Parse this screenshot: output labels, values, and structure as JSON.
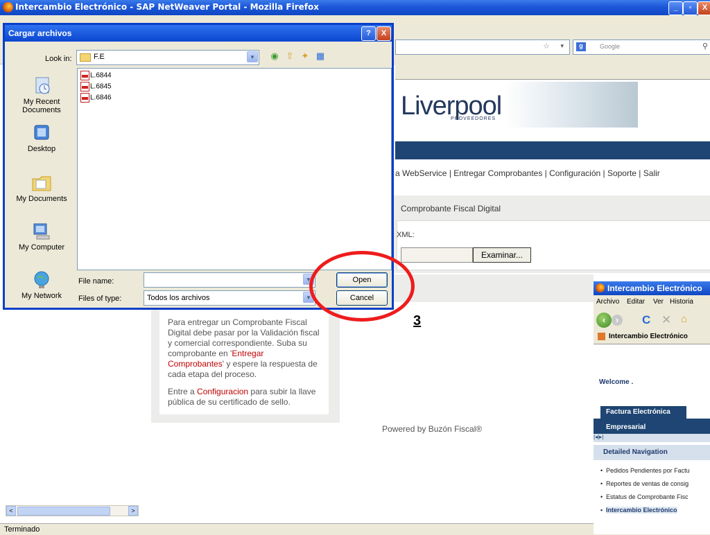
{
  "window": {
    "title": "Intercambio Electrónico - SAP NetWeaver Portal - Mozilla Firefox",
    "search_placeholder": "Google",
    "status": "Terminado"
  },
  "page": {
    "brand": "Liverpool",
    "brand_sub": "PROVEEDORES",
    "topnav": "a WebService |  Entregar Comprobantes |  Configuración |  Soporte |  Salir",
    "panel_title": "Comprobante Fiscal Digital",
    "xml_label": "XML:",
    "browse_button": "Examinar...",
    "info_p1_a": "Para entregar un Comprobante Fiscal Digital debe pasar por la Validación fiscal y comercial correspondiente. Suba su comprobante en '",
    "info_p1_link": "Entregar Comprobantes",
    "info_p1_b": "' y espere la respuesta de cada etapa del proceso.",
    "info_p2_a": "Entre a ",
    "info_p2_link": "Configuracion",
    "info_p2_b": " para subir la llave pública de su certificado de sello.",
    "powered": "Powered by Buzón Fiscal®",
    "step": "3"
  },
  "dialog": {
    "title": "Cargar archivos",
    "look_in_label": "Look in:",
    "look_in_value": "F.E",
    "places": [
      "My Recent Documents",
      "Desktop",
      "My Documents",
      "My Computer",
      "My Network"
    ],
    "files": [
      "L.6844",
      "L.6845",
      "L.6846"
    ],
    "file_name_label": "File name:",
    "file_name_value": "",
    "files_of_type_label": "Files of type:",
    "files_of_type_value": "Todos los archivos",
    "open_button": "Open",
    "cancel_button": "Cancel",
    "help_glyph": "?",
    "close_glyph": "X"
  },
  "window2": {
    "title": "Intercambio Electrónico",
    "menu": [
      "Archivo",
      "Editar",
      "Ver",
      "Historia"
    ],
    "tab": "Intercambio Electrónico",
    "welcome": "Welcome .",
    "tab1": "Factura Electrónica",
    "tab2": "Empresarial",
    "detail_header": "Detailed Navigation",
    "links": [
      "Pedidos Pendientes por Factu",
      "Reportes de ventas de consig",
      "Estatus de Comprobante Fisc",
      "Intercambio Electrónico"
    ]
  },
  "colors": {
    "accent": "#1e4573",
    "highlight_circle": "#ee1c1c",
    "link_red": "#c00000"
  }
}
